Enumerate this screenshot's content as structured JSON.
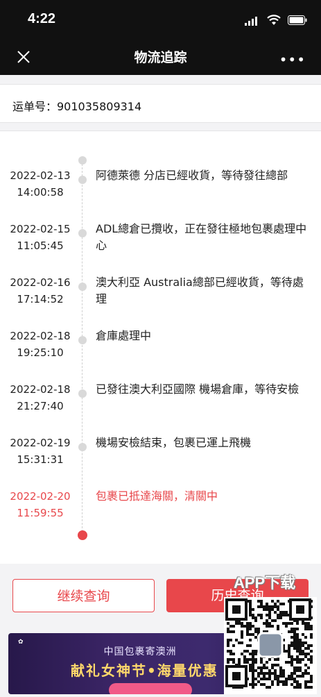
{
  "status_bar": {
    "time": "4:22"
  },
  "nav": {
    "title": "物流追踪",
    "close_icon": "close-icon",
    "more_icon": "more-icon"
  },
  "waybill": {
    "label": "运单号：901035809314"
  },
  "timeline": [
    {
      "date": "2022-02-13",
      "time": "14:00:58",
      "text": "阿德萊德 分店已經收貨，等待發往總部",
      "active": false
    },
    {
      "date": "2022-02-15",
      "time": "11:05:45",
      "text": "ADL總倉已攬收，正在發往極地包裹處理中心",
      "active": false
    },
    {
      "date": "2022-02-16",
      "time": "17:14:52",
      "text": "澳大利亞 Australia總部已經收貨，等待處理",
      "active": false
    },
    {
      "date": "2022-02-18",
      "time": "19:25:10",
      "text": "倉庫處理中",
      "active": false
    },
    {
      "date": "2022-02-18",
      "time": "21:27:40",
      "text": "已發往澳大利亞國際 機場倉庫，等待安檢",
      "active": false
    },
    {
      "date": "2022-02-19",
      "time": "15:31:31",
      "text": "機場安檢結束，包裹已運上飛機",
      "active": false
    },
    {
      "date": "2022-02-20",
      "time": "11:59:55",
      "text": "包裹已抵達海關，清關中",
      "active": true
    }
  ],
  "buttons": {
    "continue": "继续查询",
    "history": "历史查询"
  },
  "banner": {
    "subtitle": "中国包裹寄澳洲",
    "headline": "献礼女神节•海量优惠"
  },
  "qr": {
    "label": "APP下载"
  },
  "colors": {
    "accent": "#e8474b",
    "dark": "#111111"
  }
}
